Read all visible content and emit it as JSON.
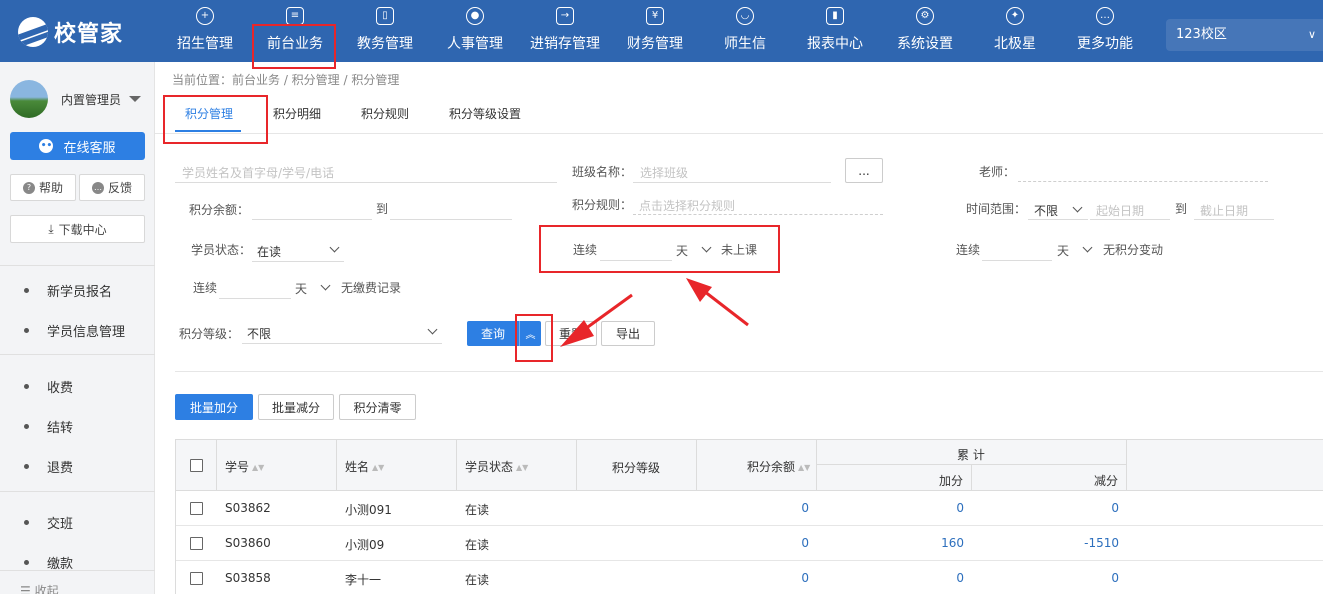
{
  "app": {
    "name": "校管家"
  },
  "nav": [
    {
      "label": "招生管理",
      "icon": "person-add-icon"
    },
    {
      "label": "前台业务",
      "icon": "desk-icon"
    },
    {
      "label": "教务管理",
      "icon": "book-icon"
    },
    {
      "label": "人事管理",
      "icon": "person-icon"
    },
    {
      "label": "进销存管理",
      "icon": "inventory-icon"
    },
    {
      "label": "财务管理",
      "icon": "finance-icon"
    },
    {
      "label": "师生信",
      "icon": "message-icon"
    },
    {
      "label": "报表中心",
      "icon": "report-icon"
    },
    {
      "label": "系统设置",
      "icon": "gear-icon"
    },
    {
      "label": "北极星",
      "icon": "star-icon"
    },
    {
      "label": "更多功能",
      "icon": "more-icon"
    }
  ],
  "campus": {
    "label": "123校区"
  },
  "sidebar": {
    "user_name": "内置管理员",
    "service_label": "在线客服",
    "help_label": "帮助",
    "feedback_label": "反馈",
    "download_label": "下载中心",
    "items": [
      "新学员报名",
      "学员信息管理",
      "收费",
      "结转",
      "退费",
      "交班",
      "缴款"
    ],
    "collapse_label": "收起"
  },
  "breadcrumb": "当前位置：前台业务 / 积分管理 / 积分管理",
  "tabs": [
    "积分管理",
    "积分明细",
    "积分规则",
    "积分等级设置"
  ],
  "filters": {
    "student_search_placeholder": "学员姓名及首字母/学号/电话",
    "class_label": "班级名称：",
    "class_placeholder": "选择班级",
    "dots_label": "...",
    "teacher_label": "老师：",
    "balance_label": "积分余额：",
    "to_label": "到",
    "rule_label": "积分规则：",
    "rule_placeholder": "点击选择积分规则",
    "time_label": "时间范围：",
    "time_value": "不限",
    "start_placeholder": "起始日期",
    "end_placeholder": "截止日期",
    "status_label": "学员状态：",
    "status_value": "在读",
    "consecutive_label": "连续",
    "day_label": "天",
    "no_class_label": "未上课",
    "no_change_label": "无积分变动",
    "no_payment_label": "无缴费记录",
    "level_label": "积分等级：",
    "level_value": "不限"
  },
  "buttons": {
    "query": "查询",
    "reset": "重置",
    "export": "导出",
    "batch_add": "批量加分",
    "batch_subtract": "批量减分",
    "clear": "积分清零"
  },
  "table": {
    "headers": {
      "id": "学号",
      "name": "姓名",
      "status": "学员状态",
      "level": "积分等级",
      "balance": "积分余额",
      "cumulative": "累 计",
      "add": "加分",
      "subtract": "减分"
    },
    "rows": [
      {
        "id": "S03862",
        "name": "小测091",
        "status": "在读",
        "balance": "0",
        "add": "0",
        "subtract": "0"
      },
      {
        "id": "S03860",
        "name": "小测09",
        "status": "在读",
        "balance": "0",
        "add": "160",
        "subtract": "-1510"
      },
      {
        "id": "S03858",
        "name": "李十一",
        "status": "在读",
        "balance": "0",
        "add": "0",
        "subtract": "0"
      }
    ]
  },
  "colors": {
    "topbar": "#2f66b0",
    "accent": "#2d7fe3",
    "highlight": "#e8262a"
  }
}
